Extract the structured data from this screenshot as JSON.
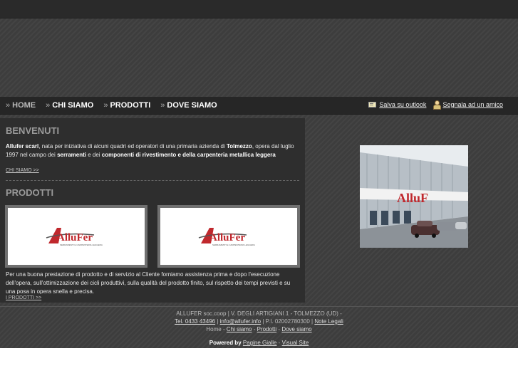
{
  "nav": {
    "items": [
      {
        "label": "HOME",
        "active": true
      },
      {
        "label": "CHI SIAMO",
        "active": false
      },
      {
        "label": "PRODOTTI",
        "active": false
      },
      {
        "label": "DOVE SIAMO",
        "active": false
      }
    ],
    "chevron": "»"
  },
  "tools": {
    "outlook_label": "Salva su outlook",
    "friend_label": "Segnala ad un amico"
  },
  "welcome": {
    "title": "BENVENUTI",
    "p1_brand": "Allufer scarl",
    "p1_a": ", nata per iniziativa di alcuni quadri ed operatori di una primaria azienda di ",
    "p1_city": "Tolmezzo",
    "p1_b": ", opera dal luglio 1997 nel campo dei ",
    "p1_serr": "serramenti",
    "p1_c": " e dei ",
    "p1_comp": "componenti di rivestimento e della carpenteria metallica leggera",
    "more": "CHI SIAMO >>"
  },
  "products": {
    "title": "PRODOTTI",
    "logo_text": "AlluFer",
    "logo_sub": "SERRAMENTI E CARPENTERIA LEGGERA",
    "text": "Per una buona prestazione di prodotto e di servizio al Cliente forniamo assistenza prima e dopo l'esecuzione dell'opera, sull'ottimizzazione dei cicli produttivi, sulla qualità del prodotto finito, sul rispetto dei tempi previsti e su una posa in opera snella e precisa.",
    "more": "I PRODOTTI >>"
  },
  "photo": {
    "sign_text": "AlluF"
  },
  "footer": {
    "line1": "ALLUFER soc.coop | V. DEGLI ARTIGIANI 1 - TOLMEZZO (UD) -",
    "tel": "Tel. 0433 43496",
    "email": "info@allufer.info",
    "piva": "| P.I. 02002780300 |",
    "legal": "Note Legali",
    "sep": "|",
    "nav": [
      "Home",
      "Chi siamo",
      "Prodotti",
      "Dove siamo"
    ],
    "nav_sep": "-",
    "powered": "Powered by",
    "pg": "Pagine Gialle",
    "dash": "-",
    "vs": "Visual Site"
  },
  "colors": {
    "background": "#3d3d3d",
    "navbar": "#262626",
    "content_panel": "#2e2e2e",
    "logo_red": "#c0282d"
  }
}
